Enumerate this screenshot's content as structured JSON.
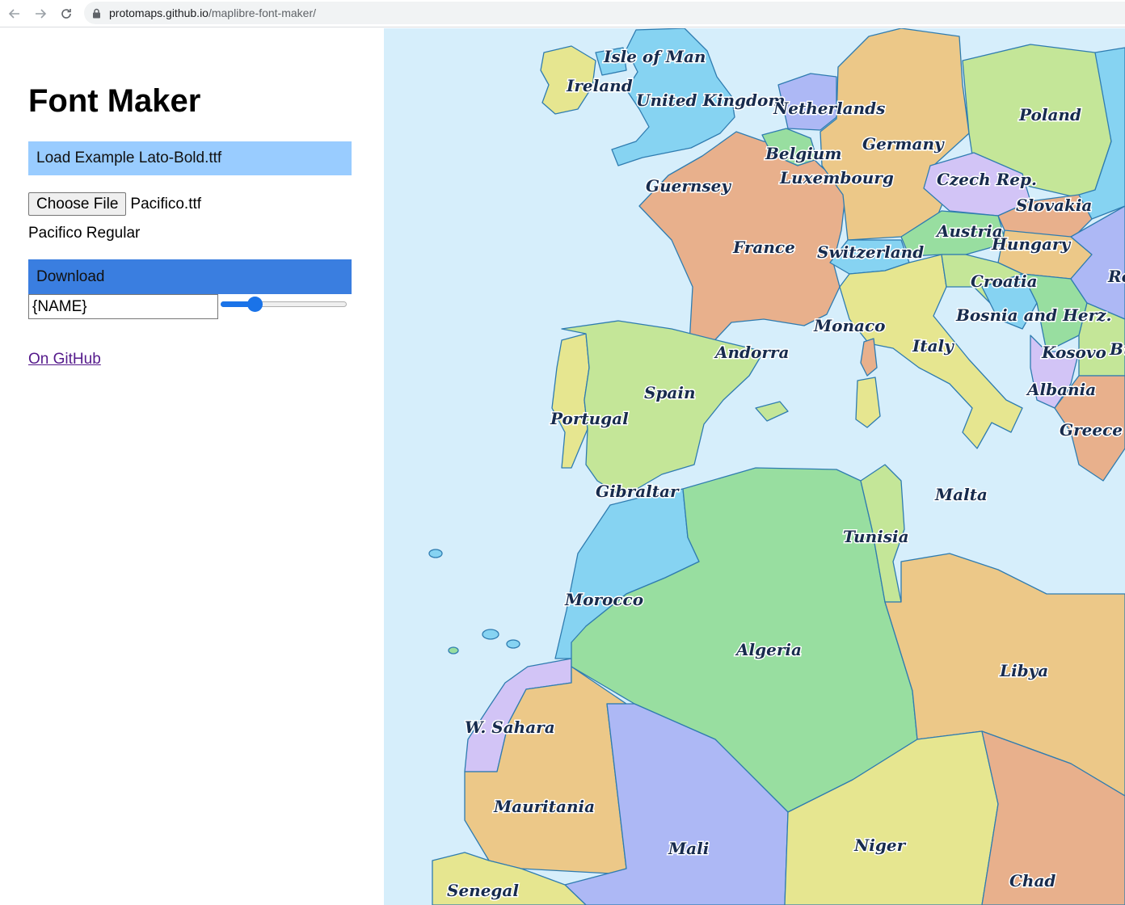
{
  "browser": {
    "url_host": "protomaps.github.io",
    "url_path": "/maplibre-font-maker/"
  },
  "sidebar": {
    "title": "Font Maker",
    "load_example_label": "Load Example Lato-Bold.ttf",
    "choose_file_label": "Choose File",
    "selected_file": "Pacifico.ttf",
    "font_name": "Pacifico Regular",
    "download_label": "Download",
    "name_template_value": "{NAME}",
    "slider_fraction": 0.24,
    "github_link": "On GitHub"
  },
  "map": {
    "colors": {
      "water": "#d6eefb",
      "border": "#2f7cb0"
    },
    "labels": [
      {
        "name": "isle-of-man",
        "text": "Isle of Man"
      },
      {
        "name": "ireland",
        "text": "Ireland"
      },
      {
        "name": "united-kingdom",
        "text": "United Kingdom"
      },
      {
        "name": "netherlands",
        "text": "Netherlands"
      },
      {
        "name": "poland",
        "text": "Poland"
      },
      {
        "name": "germany",
        "text": "Germany"
      },
      {
        "name": "belgium",
        "text": "Belgium"
      },
      {
        "name": "luxembourg",
        "text": "Luxembourg"
      },
      {
        "name": "czech-rep",
        "text": "Czech Rep."
      },
      {
        "name": "guernsey",
        "text": "Guernsey"
      },
      {
        "name": "slovakia",
        "text": "Slovakia"
      },
      {
        "name": "austria",
        "text": "Austria"
      },
      {
        "name": "hungary",
        "text": "Hungary"
      },
      {
        "name": "france",
        "text": "France"
      },
      {
        "name": "switzerland",
        "text": "Switzerland"
      },
      {
        "name": "croatia",
        "text": "Croatia"
      },
      {
        "name": "romania-partial",
        "text": "Ro"
      },
      {
        "name": "bosnia",
        "text": "Bosnia and Herz."
      },
      {
        "name": "monaco",
        "text": "Monaco"
      },
      {
        "name": "italy",
        "text": "Italy"
      },
      {
        "name": "andorra",
        "text": "Andorra"
      },
      {
        "name": "kosovo",
        "text": "Kosovo"
      },
      {
        "name": "bulgaria-partial",
        "text": "Bu"
      },
      {
        "name": "spain",
        "text": "Spain"
      },
      {
        "name": "albania",
        "text": "Albania"
      },
      {
        "name": "portugal",
        "text": "Portugal"
      },
      {
        "name": "greece",
        "text": "Greece"
      },
      {
        "name": "gibraltar",
        "text": "Gibraltar"
      },
      {
        "name": "malta",
        "text": "Malta"
      },
      {
        "name": "tunisia",
        "text": "Tunisia"
      },
      {
        "name": "morocco",
        "text": "Morocco"
      },
      {
        "name": "algeria",
        "text": "Algeria"
      },
      {
        "name": "libya",
        "text": "Libya"
      },
      {
        "name": "w-sahara",
        "text": "W. Sahara"
      },
      {
        "name": "mauritania",
        "text": "Mauritania"
      },
      {
        "name": "mali",
        "text": "Mali"
      },
      {
        "name": "niger",
        "text": "Niger"
      },
      {
        "name": "chad",
        "text": "Chad"
      },
      {
        "name": "senegal",
        "text": "Senegal"
      }
    ]
  }
}
